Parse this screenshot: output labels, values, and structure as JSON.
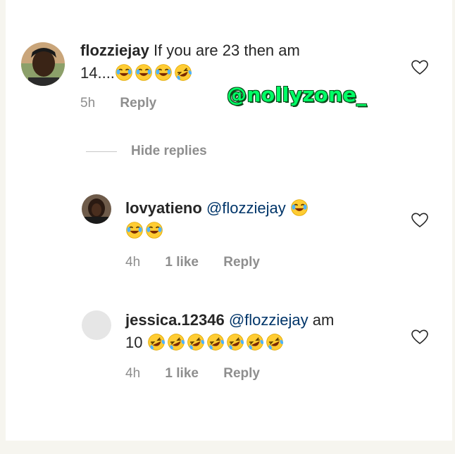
{
  "comments": [
    {
      "username": "flozziejay",
      "text_line1": "If you are 23 then am",
      "text_line2": "14....",
      "emojis": [
        "joy-emoji",
        "joy-emoji",
        "joy-emoji",
        "rofl-emoji"
      ],
      "time": "5h",
      "reply": "Reply"
    }
  ],
  "hide_replies": "Hide replies",
  "replies": [
    {
      "username": "lovyatieno",
      "mention": "@flozziejay",
      "time": "4h",
      "likes": "1 like",
      "reply": "Reply"
    },
    {
      "username": "jessica.12346",
      "mention": "@flozziejay",
      "text_after": "am",
      "text_line2": "10",
      "time": "4h",
      "likes": "1 like",
      "reply": "Reply"
    }
  ],
  "watermark": "@nollyzone_",
  "colors": {
    "text": "#262626",
    "meta": "#8e8e8e",
    "mention": "#003569",
    "watermark": "#00ff66"
  }
}
